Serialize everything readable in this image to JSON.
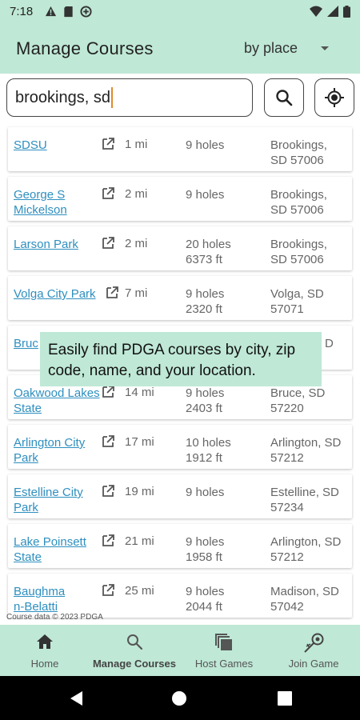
{
  "status": {
    "time": "7:18"
  },
  "app_bar": {
    "title": "Manage Courses",
    "sort_value": "by place"
  },
  "search": {
    "value": "brookings, sd"
  },
  "courses": [
    {
      "name": "SDSU",
      "distance": "1 mi",
      "holes": "9 holes",
      "length": "",
      "addr1": "Brookings,",
      "addr2": "SD 57006"
    },
    {
      "name": "George S Mickelson",
      "distance": "2 mi",
      "holes": "9 holes",
      "length": "",
      "addr1": "Brookings,",
      "addr2": "SD 57006"
    },
    {
      "name": "Larson Park",
      "distance": "2 mi",
      "holes": "20 holes",
      "length": "6373 ft",
      "addr1": "Brookings,",
      "addr2": "SD 57006"
    },
    {
      "name": "Volga City Park",
      "distance": "7 mi",
      "holes": "9 holes",
      "length": "2320 ft",
      "addr1": "Volga, SD",
      "addr2": "57071"
    },
    {
      "name": "Bruc",
      "distance": "",
      "holes": "",
      "length": "",
      "addr1": "D",
      "addr2": ""
    },
    {
      "name": "Oakwood Lakes State",
      "distance": "14 mi",
      "holes": "9 holes",
      "length": "2403 ft",
      "addr1": "Bruce, SD",
      "addr2": "57220"
    },
    {
      "name": "Arlington City Park",
      "distance": "17 mi",
      "holes": "10 holes",
      "length": "1912 ft",
      "addr1": "Arlington, SD",
      "addr2": "57212"
    },
    {
      "name": "Estelline City Park",
      "distance": "19 mi",
      "holes": "9 holes",
      "length": "",
      "addr1": "Estelline, SD",
      "addr2": "57234"
    },
    {
      "name": "Lake Poinsett State",
      "distance": "21 mi",
      "holes": "9 holes",
      "length": "1958 ft",
      "addr1": "Arlington, SD",
      "addr2": "57212"
    },
    {
      "name": "Baughma n-Belatti",
      "distance": "25 mi",
      "holes": "9 holes",
      "length": "2044 ft",
      "addr1": "Madison, SD",
      "addr2": "57042"
    }
  ],
  "tooltip": {
    "text": "Easily find PDGA courses by city, zip code, name, and your location."
  },
  "footer": {
    "copyright": "Course data © 2023 PDGA"
  },
  "nav": {
    "home": "Home",
    "manage": "Manage Courses",
    "host": "Host Games",
    "join": "Join Game"
  },
  "colors": {
    "accent": "#bfe8d6",
    "link": "#2e8fbf"
  }
}
